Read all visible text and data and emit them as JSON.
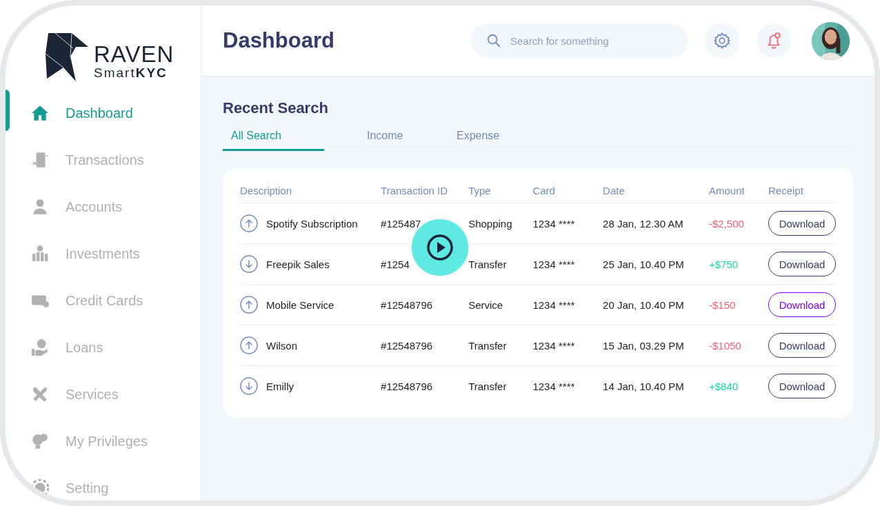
{
  "logo": {
    "name": "RAVEN",
    "tagline_light": "Smart",
    "tagline_bold": "KYC"
  },
  "sidebar": {
    "items": [
      {
        "label": "Dashboard",
        "selected": true
      },
      {
        "label": "Transactions",
        "selected": false
      },
      {
        "label": "Accounts",
        "selected": false
      },
      {
        "label": "Investments",
        "selected": false
      },
      {
        "label": "Credit Cards",
        "selected": false
      },
      {
        "label": "Loans",
        "selected": false
      },
      {
        "label": "Services",
        "selected": false
      },
      {
        "label": "My Privileges",
        "selected": false
      },
      {
        "label": "Setting",
        "selected": false
      }
    ]
  },
  "header": {
    "title": "Dashboard",
    "search": {
      "placeholder": "Search for something"
    },
    "notifications": {
      "unread": true
    }
  },
  "section": {
    "title": "Recent Search"
  },
  "tabs": [
    {
      "label": "All Search",
      "selected": true
    },
    {
      "label": "Income",
      "selected": false
    },
    {
      "label": "Expense",
      "selected": false
    }
  ],
  "table": {
    "columns": [
      "Description",
      "Transaction ID",
      "Type",
      "Card",
      "Date",
      "Amount",
      "Receipt"
    ],
    "rows": [
      {
        "incoming": false,
        "description": "Spotify Subscription",
        "transaction_id": "#125487",
        "type": "Shopping",
        "card": "1234 ****",
        "date": "28 Jan, 12.30 AM",
        "amount": "-$2,500",
        "receipt": "Download",
        "selected": false
      },
      {
        "incoming": true,
        "description": "Freepik Sales",
        "transaction_id": "#1254",
        "type": "Transfer",
        "card": "1234 ****",
        "date": "25 Jan, 10.40 PM",
        "amount": "+$750",
        "receipt": "Download",
        "selected": false
      },
      {
        "incoming": false,
        "description": "Mobile Service",
        "transaction_id": "#12548796",
        "type": "Service",
        "card": "1234 ****",
        "date": "20 Jan, 10.40 PM",
        "amount": "-$150",
        "receipt": "Download",
        "selected": true
      },
      {
        "incoming": false,
        "description": "Wilson",
        "transaction_id": "#12548796",
        "type": "Transfer",
        "card": "1234 ****",
        "date": "15 Jan, 03.29 PM",
        "amount": "-$1050",
        "receipt": "Download",
        "selected": false
      },
      {
        "incoming": true,
        "description": "Emilly",
        "transaction_id": "#12548796",
        "type": "Transfer",
        "card": "1234 ****",
        "date": "14 Jan, 10.40 PM",
        "amount": "+$840",
        "receipt": "Download",
        "selected": false
      }
    ]
  },
  "video_overlay": {
    "kind": "play"
  }
}
